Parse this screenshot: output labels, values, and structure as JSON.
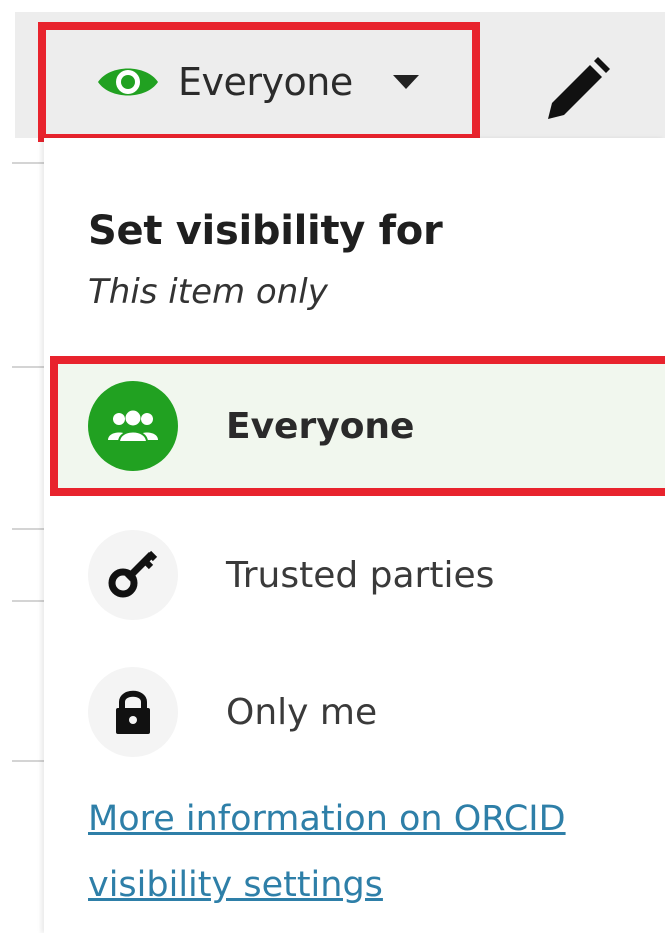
{
  "toolbar": {
    "visibility_label": "Everyone",
    "eye_icon": "eye-icon",
    "caret_icon": "caret-down-icon",
    "edit_icon": "pencil-icon"
  },
  "panel": {
    "heading": "Set visibility for",
    "subheading": "This item only",
    "options": [
      {
        "label": "Everyone",
        "icon": "group-icon",
        "selected": true
      },
      {
        "label": "Trusted parties",
        "icon": "key-icon",
        "selected": false
      },
      {
        "label": "Only me",
        "icon": "lock-icon",
        "selected": false
      }
    ],
    "info_link": "More information on ORCID visibility settings"
  },
  "colors": {
    "highlight": "#e8232d",
    "everyone_green": "#21a121",
    "link": "#2e7fa8"
  }
}
